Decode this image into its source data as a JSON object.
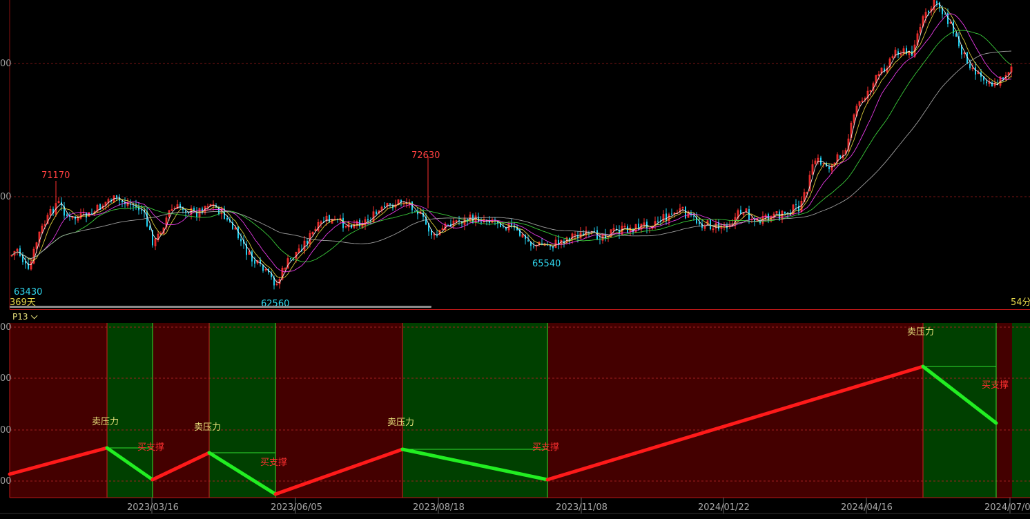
{
  "upper_chart": {
    "type": "candlestick",
    "ma_colors": [
      "#ffffff",
      "#f0e040",
      "#ff40ff",
      "#40e040",
      "#b0b0b0"
    ],
    "up_color": "#ff3030",
    "down_color": "#20d0f0",
    "price_grid_labels": [
      "00",
      "00"
    ],
    "annotations": [
      {
        "text": "71170",
        "kind": "high"
      },
      {
        "text": "72630",
        "kind": "high"
      },
      {
        "text": "63430",
        "kind": "low"
      },
      {
        "text": "62560",
        "kind": "low"
      },
      {
        "text": "65540",
        "kind": "low"
      }
    ],
    "period_left": "369天",
    "period_right": "54分"
  },
  "indicator": {
    "tab_label": "P13",
    "grid_labels": [
      "00",
      "00",
      "00",
      "00"
    ],
    "signal_labels": {
      "sell": "卖压力",
      "buy": "买支撑"
    },
    "colors": {
      "rise": "#ff1a1a",
      "fall": "#22ee22",
      "bg_rise": "#440000",
      "bg_fall": "#004000"
    },
    "segments": [
      {
        "from": "start",
        "to": "1",
        "dir": "rise"
      },
      {
        "from": "1",
        "to": "2",
        "dir": "fall"
      },
      {
        "from": "2",
        "to": "3",
        "dir": "rise"
      },
      {
        "from": "3",
        "to": "4",
        "dir": "fall"
      },
      {
        "from": "4",
        "to": "5",
        "dir": "rise"
      },
      {
        "from": "5",
        "to": "6",
        "dir": "fall"
      },
      {
        "from": "6",
        "to": "7",
        "dir": "rise"
      },
      {
        "from": "7",
        "to": "8",
        "dir": "fall"
      }
    ]
  },
  "x_axis": {
    "dates": [
      "2023/03/16",
      "2023/06/05",
      "2023/08/18",
      "2023/11/08",
      "2024/01/22",
      "2024/04/16",
      "2024/07/0"
    ]
  }
}
